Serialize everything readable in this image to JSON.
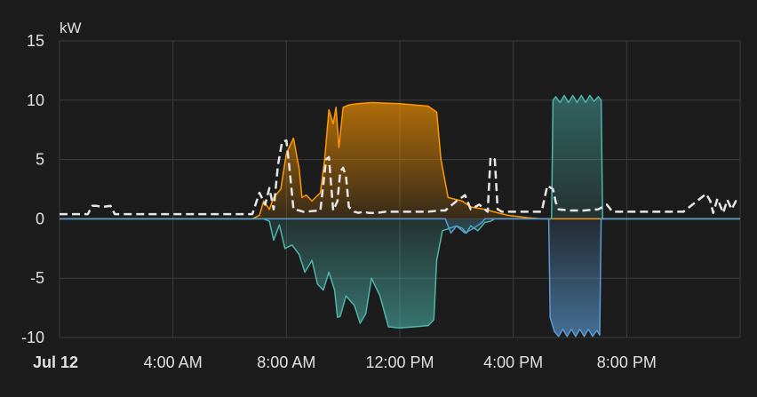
{
  "chart_data": {
    "type": "area",
    "ylabel": "kW",
    "ylim": [
      -10,
      15
    ],
    "y_ticks": [
      15,
      10,
      5,
      0,
      -5,
      -10
    ],
    "x_range_hours": [
      0,
      24
    ],
    "x_ticks": [
      {
        "hour": 0,
        "label": "Jul 12",
        "bold": true
      },
      {
        "hour": 4,
        "label": "4:00 AM"
      },
      {
        "hour": 8,
        "label": "8:00 AM"
      },
      {
        "hour": 12,
        "label": "12:00 PM"
      },
      {
        "hour": 16,
        "label": "4:00 PM"
      },
      {
        "hour": 20,
        "label": "8:00 PM"
      }
    ],
    "grid": true,
    "colors": {
      "background": "#1c1c1c",
      "grid": "#3c3c3c",
      "axis_text": "#e1e1e1",
      "solar": "#ff9800",
      "battery": "#4db6ac",
      "grid_import": "#5b9bd5",
      "consumption": "#e6e6e6"
    },
    "series": [
      {
        "key": "solar",
        "style": "area",
        "x": [
          0,
          6.8,
          7.05,
          7.2,
          7.4,
          7.55,
          7.8,
          8.0,
          8.25,
          8.45,
          8.55,
          8.7,
          8.9,
          9.2,
          9.35,
          9.5,
          9.65,
          9.75,
          9.85,
          10.0,
          10.2,
          10.5,
          11.0,
          12.0,
          13.0,
          13.3,
          13.45,
          13.7,
          14.2,
          14.5,
          15.0,
          15.3,
          15.8,
          16.5,
          17.0,
          24
        ],
        "values": [
          0,
          0,
          0.3,
          1.5,
          0.8,
          1.8,
          2.5,
          5.5,
          6.8,
          4.2,
          1.8,
          2.0,
          1.5,
          2.2,
          5.0,
          9.2,
          8.0,
          9.4,
          6.0,
          9.4,
          9.6,
          9.7,
          9.8,
          9.7,
          9.5,
          9.0,
          5.0,
          1.8,
          1.5,
          1.0,
          0.8,
          0.6,
          0.3,
          0.1,
          0,
          0
        ]
      },
      {
        "key": "battery",
        "style": "area",
        "x": [
          0,
          7.2,
          7.4,
          7.55,
          7.75,
          7.95,
          8.2,
          8.45,
          8.65,
          8.9,
          9.1,
          9.3,
          9.5,
          9.7,
          9.8,
          9.9,
          10.1,
          10.4,
          10.6,
          10.8,
          11.0,
          11.3,
          11.6,
          12.0,
          12.5,
          13.0,
          13.2,
          13.3,
          13.5,
          14.0,
          14.2,
          14.35,
          14.5,
          14.75,
          15.0,
          15.2,
          15.35,
          17.35,
          17.4,
          17.5,
          17.65,
          17.8,
          17.95,
          18.1,
          18.25,
          18.4,
          18.55,
          18.7,
          18.85,
          19.0,
          19.1,
          19.15,
          24
        ],
        "values": [
          0,
          0,
          -0.2,
          -1.8,
          -0.5,
          -2.5,
          -2.2,
          -3.0,
          -4.5,
          -3.5,
          -5.5,
          -6.0,
          -4.5,
          -6.0,
          -8.3,
          -8.2,
          -6.5,
          -7.3,
          -8.8,
          -8.0,
          -5.0,
          -6.5,
          -9.1,
          -9.2,
          -9.1,
          -9.0,
          -8.5,
          -3.5,
          -1.0,
          -0.6,
          -0.8,
          -1.2,
          -0.6,
          -1.0,
          -0.3,
          -0.2,
          0,
          0,
          10.0,
          10.3,
          9.8,
          10.4,
          9.8,
          10.4,
          9.8,
          10.4,
          9.8,
          10.4,
          9.9,
          10.3,
          10.0,
          0,
          0
        ]
      },
      {
        "key": "grid_import",
        "style": "area",
        "x": [
          0,
          13.6,
          13.8,
          14.0,
          14.3,
          14.6,
          14.9,
          15.0,
          17.25,
          17.3,
          17.45,
          17.6,
          17.75,
          17.9,
          18.05,
          18.2,
          18.35,
          18.5,
          18.65,
          18.8,
          18.95,
          19.05,
          19.1,
          24
        ],
        "values": [
          0,
          0,
          -1.2,
          -0.6,
          -1.2,
          -0.8,
          -0.3,
          0,
          0,
          -8.3,
          -9.5,
          -9.9,
          -9.3,
          -9.9,
          -9.3,
          -9.9,
          -9.3,
          -9.9,
          -9.3,
          -9.9,
          -9.4,
          -9.8,
          0,
          0
        ]
      },
      {
        "key": "consumption",
        "style": "dashed-line",
        "x": [
          0,
          1.0,
          1.15,
          1.3,
          1.5,
          1.8,
          1.95,
          2.1,
          3.0,
          5.0,
          6.8,
          7.05,
          7.25,
          7.4,
          7.55,
          7.7,
          7.85,
          8.0,
          8.1,
          8.25,
          8.45,
          8.6,
          9.2,
          9.4,
          9.5,
          9.65,
          9.8,
          9.9,
          10.0,
          10.1,
          10.2,
          10.4,
          10.55,
          10.7,
          10.9,
          11.0,
          11.2,
          11.5,
          12.0,
          13.0,
          13.4,
          13.6,
          14.0,
          14.3,
          14.5,
          14.8,
          15.1,
          15.2,
          15.35,
          15.45,
          15.6,
          16.0,
          16.5,
          17.0,
          17.2,
          17.4,
          17.5,
          17.6,
          18.0,
          18.5,
          19.0,
          19.3,
          19.5,
          20.0,
          21.0,
          22.0,
          22.8,
          22.95,
          23.05,
          23.2,
          23.4,
          23.55,
          23.7,
          23.85,
          24
        ],
        "values": [
          0.4,
          0.4,
          1.1,
          1.1,
          1.0,
          1.1,
          0.4,
          0.4,
          0.4,
          0.4,
          0.4,
          2.2,
          1.2,
          2.6,
          0.8,
          4.5,
          6.5,
          6.6,
          4.5,
          0.8,
          0.7,
          0.6,
          0.7,
          5.0,
          5.2,
          0.7,
          1.5,
          4.0,
          4.3,
          3.6,
          1.0,
          0.6,
          0.5,
          0.6,
          0.5,
          0.5,
          0.5,
          0.6,
          0.6,
          0.6,
          0.7,
          0.7,
          1.5,
          2.0,
          0.8,
          1.2,
          0.6,
          5.2,
          5.0,
          0.8,
          0.6,
          0.6,
          0.6,
          0.6,
          2.8,
          2.5,
          1.4,
          0.8,
          0.7,
          0.7,
          0.8,
          1.2,
          0.6,
          0.6,
          0.6,
          0.6,
          2.1,
          1.5,
          0.5,
          1.7,
          0.5,
          1.6,
          0.8,
          1.5,
          1.4
        ]
      }
    ]
  }
}
